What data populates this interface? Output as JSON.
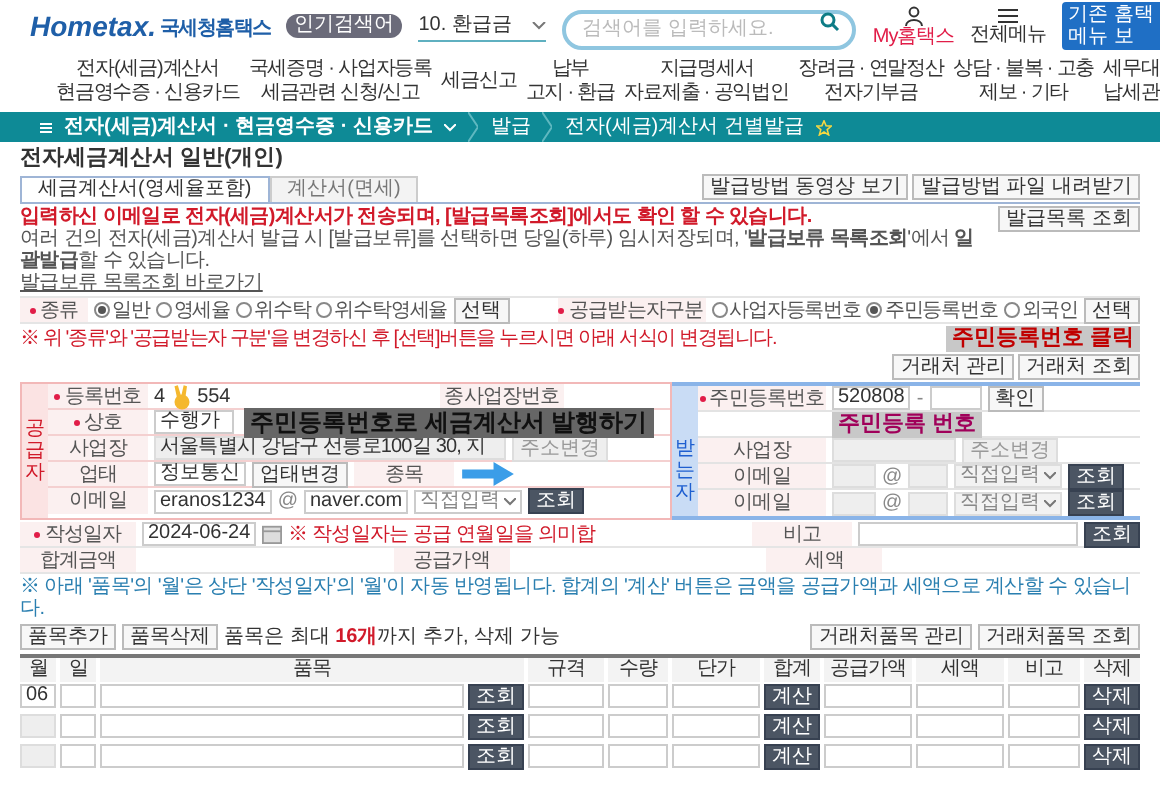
{
  "header": {
    "logo": {
      "brand": "Hometax.",
      "name": "국세청홈택스"
    },
    "popular_badge": "인기검색어",
    "popular_term": "10. 환급금",
    "search": {
      "placeholder": "검색어를 입력하세요."
    },
    "my_link": "My홈택스",
    "menu_link": "전체메뉴",
    "legacy_button": [
      "기존 홈택",
      "메뉴 보"
    ]
  },
  "nav": [
    [
      "전자(세금)계산서",
      "현금영수증 · 신용카드"
    ],
    [
      "국세증명 · 사업자등록",
      "세금관련 신청/신고"
    ],
    [
      "세금신고"
    ],
    [
      "납부",
      "고지 · 환급"
    ],
    [
      "지급명세서",
      "자료제출 · 공익법인"
    ],
    [
      "장려금 · 연말정산",
      "전자기부금"
    ],
    [
      "상담 · 불복 · 고충",
      "제보 · 기타"
    ],
    [
      "세무대",
      "납세관"
    ]
  ],
  "breadcrumb": {
    "section": "전자(세금)계산서 · 현금영수증 · 신용카드",
    "items": [
      "발급",
      "전자(세금)계산서 건별발급"
    ],
    "favorite": false
  },
  "title": "전자세금계산서 일반(개인)",
  "tabs": [
    {
      "label": "세금계산서(영세율포함)",
      "selected": true
    },
    {
      "label": "계산서(면세)",
      "selected": false
    }
  ],
  "top_buttons": [
    "발급방법 동영상 보기",
    "발급방법 파일 내려받기"
  ],
  "notice": {
    "alert": "입력하신 이메일로 전자(세금)계산서가 전송되며, [발급목록조회]에서도 확인 할 수 있습니다.",
    "info": "여러 건의 전자(세금)계산서 발급 시 [발급보류]를 선택하면 당일(하루) 임시저장되며, '**발급보류 목록조회**'에서 **일괄발급**할 수 있습니다.",
    "link": "발급보류 목록조회 바로가기",
    "button": "발급목록 조회"
  },
  "type_row": {
    "label": "종류",
    "options": [
      {
        "label": "일반",
        "selected": true
      },
      {
        "label": "영세율",
        "selected": false
      },
      {
        "label": "위수탁",
        "selected": false
      },
      {
        "label": "위수탁영세율",
        "selected": false
      }
    ],
    "button": "선택"
  },
  "buyer_type_row": {
    "label": "공급받는자구분",
    "options": [
      {
        "label": "사업자등록번호",
        "selected": false
      },
      {
        "label": "주민등록번호",
        "selected": true
      },
      {
        "label": "외국인",
        "selected": false
      }
    ],
    "button": "선택"
  },
  "change_note": "※ 위 '종류'와 '공급받는자 구분'을 변경하신 후 [선택]버튼을 누르시면 아래 서식이 변경됩니다.",
  "captions": {
    "click": "주민등록번호 클릭",
    "issue": "주민등록번호로 세금계산서 발행하기",
    "resident": "주민등록 번호"
  },
  "partner_buttons": [
    "거래처 관리",
    "거래처 조회"
  ],
  "supplier": {
    "side_label": "공급자",
    "reg_label": "등록번호",
    "reg_start": "4",
    "reg_end": "554",
    "branch_label": "종사업장번호",
    "name_label": "상호",
    "name_value": "수행가",
    "address_label": "사업장",
    "address_value": "서울특별시 강남구 선릉로100길 30, 지",
    "address_button": "주소변경",
    "business_label": "업태",
    "business_value": "정보통신",
    "business_button": "업태변경",
    "item_label": "종목",
    "email_label": "이메일",
    "email_id": "eranos1234",
    "at": "@",
    "email_domain": "naver.com",
    "email_select": "직접입력",
    "email_button": "조회"
  },
  "buyer": {
    "side_label": "받는자",
    "reg_label": "주민등록번호",
    "reg_value": "520808",
    "reg_dash": "-",
    "reg_button": "확인",
    "address_label": "사업장",
    "address_button": "주소변경",
    "emails": [
      {
        "label": "이메일",
        "at": "@",
        "select": "직접입력",
        "button": "조회"
      },
      {
        "label": "이메일",
        "at": "@",
        "select": "직접입력",
        "button": "조회"
      }
    ]
  },
  "date_row": {
    "label": "작성일자",
    "value": "2024-06-24",
    "note": "※ 작성일자는 공급 연월일을 의미합",
    "memo_label": "비고",
    "memo_button": "조회"
  },
  "total_row": [
    "합계금액",
    "공급가액",
    "세액"
  ],
  "items_note": "※ 아래 '품목'의 '월'은 상단 '작성일자'의 '월'이 자동 반영됩니다. 합계의 '계산' 버튼은 금액을 공급가액과 세액으로 계산할 수 있습니다.",
  "item_buttons": [
    "품목추가",
    "품목삭제"
  ],
  "item_limit": {
    "before": "품목은 최대 ",
    "count": "16개",
    "after": "까지 추가, 삭제 가능"
  },
  "item_partner_buttons": [
    "거래처품목 관리",
    "거래처품목 조회"
  ],
  "table": {
    "columns": [
      "월",
      "일",
      "품목",
      "규격",
      "수량",
      "단가",
      "합계",
      "공급가액",
      "세액",
      "비고",
      "삭제"
    ],
    "rows": [
      {
        "month": "06",
        "lookup": "조회",
        "calc": "계산",
        "delete": "삭제"
      },
      {
        "month": "",
        "lookup": "조회",
        "calc": "계산",
        "delete": "삭제"
      },
      {
        "month": "",
        "lookup": "조회",
        "calc": "계산",
        "delete": "삭제"
      }
    ]
  }
}
